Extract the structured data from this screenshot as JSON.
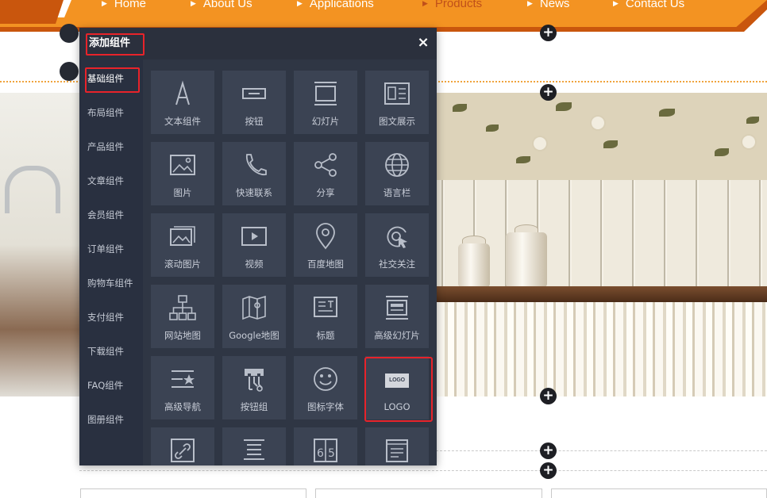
{
  "nav": {
    "items": [
      {
        "label": "Home",
        "active": false
      },
      {
        "label": "About Us",
        "active": false
      },
      {
        "label": "Applications",
        "active": false
      },
      {
        "label": "Products",
        "active": true
      },
      {
        "label": "News",
        "active": false
      },
      {
        "label": "Contact Us",
        "active": false
      }
    ]
  },
  "dialog": {
    "title": "添加组件",
    "close": "×",
    "categories": [
      {
        "label": "基础组件",
        "active": true
      },
      {
        "label": "布局组件",
        "active": false
      },
      {
        "label": "产品组件",
        "active": false
      },
      {
        "label": "文章组件",
        "active": false
      },
      {
        "label": "会员组件",
        "active": false
      },
      {
        "label": "订单组件",
        "active": false
      },
      {
        "label": "购物车组件",
        "active": false
      },
      {
        "label": "支付组件",
        "active": false
      },
      {
        "label": "下载组件",
        "active": false
      },
      {
        "label": "FAQ组件",
        "active": false
      },
      {
        "label": "图册组件",
        "active": false
      }
    ],
    "components": [
      {
        "label": "文本组件",
        "icon": "text-icon"
      },
      {
        "label": "按钮",
        "icon": "button-icon"
      },
      {
        "label": "幻灯片",
        "icon": "slideshow-icon"
      },
      {
        "label": "图文展示",
        "icon": "image-text-icon"
      },
      {
        "label": "图片",
        "icon": "image-icon"
      },
      {
        "label": "快速联系",
        "icon": "phone-icon"
      },
      {
        "label": "分享",
        "icon": "share-icon"
      },
      {
        "label": "语言栏",
        "icon": "globe-icon"
      },
      {
        "label": "滚动图片",
        "icon": "scroll-image-icon"
      },
      {
        "label": "视频",
        "icon": "video-icon"
      },
      {
        "label": "百度地图",
        "icon": "map-pin-icon"
      },
      {
        "label": "社交关注",
        "icon": "social-follow-icon"
      },
      {
        "label": "网站地图",
        "icon": "sitemap-icon"
      },
      {
        "label": "Google地图",
        "icon": "folded-map-icon"
      },
      {
        "label": "标题",
        "icon": "title-icon"
      },
      {
        "label": "高级幻灯片",
        "icon": "advanced-slideshow-icon"
      },
      {
        "label": "高级导航",
        "icon": "advanced-nav-icon"
      },
      {
        "label": "按钮组",
        "icon": "button-group-icon"
      },
      {
        "label": "图标字体",
        "icon": "smiley-icon"
      },
      {
        "label": "LOGO",
        "icon": "logo-icon",
        "icon_text": "LOGO"
      },
      {
        "label": "",
        "icon": "link-icon"
      },
      {
        "label": "",
        "icon": "list-icon"
      },
      {
        "label": "",
        "icon": "counter-icon"
      },
      {
        "label": "",
        "icon": "notepad-icon"
      }
    ]
  },
  "colors": {
    "nav_orange": "#f39322",
    "dialog_bg": "#2f3644",
    "tile_bg": "#3b4353",
    "highlight_red": "#e8232a"
  }
}
